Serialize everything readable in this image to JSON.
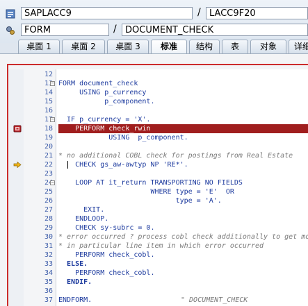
{
  "header": {
    "program": "SAPLACC9",
    "include": "LACC9F20",
    "object_type": "FORM",
    "object_name": "DOCUMENT_CHECK",
    "separator": "/"
  },
  "tabs": [
    {
      "label": "桌面 1",
      "active": false
    },
    {
      "label": "桌面 2",
      "active": false
    },
    {
      "label": "桌面 3",
      "active": false
    },
    {
      "label": "标准",
      "active": true
    },
    {
      "label": "结构",
      "active": false
    },
    {
      "label": "表",
      "active": false
    },
    {
      "label": "对象",
      "active": false
    },
    {
      "label": "详细",
      "active": false
    }
  ],
  "colors": {
    "highlight": "#a01e1e",
    "keyword": "#1c3a9e",
    "comment": "#7a7a7a",
    "frame": "#cc2b2b"
  },
  "code_lines": [
    {
      "num": "12",
      "text": "",
      "fold": "",
      "type": "code"
    },
    {
      "num": "13",
      "text": "FORM document_check",
      "fold": "−",
      "type": "code"
    },
    {
      "num": "14",
      "text": "     USING p_currency",
      "fold": "",
      "type": "code"
    },
    {
      "num": "15",
      "text": "           p_component.",
      "fold": "",
      "type": "code"
    },
    {
      "num": "16",
      "text": "",
      "fold": "",
      "type": "code"
    },
    {
      "num": "17",
      "text": "  IF p_currency = 'X'.",
      "fold": "−",
      "type": "code"
    },
    {
      "num": "18",
      "text": "    PERFORM check_rwin",
      "fold": "",
      "type": "highlight",
      "marker": "breakpoint"
    },
    {
      "num": "19",
      "text": "            USING  p_component.",
      "fold": "",
      "type": "code"
    },
    {
      "num": "20",
      "text": "",
      "fold": "",
      "type": "code"
    },
    {
      "num": "21",
      "text": "* no additional COBL check for postings from Real Estate",
      "fold": "",
      "type": "comment"
    },
    {
      "num": "22",
      "text": "    CHECK gs_aw-awtyp NP 'RE*'.",
      "fold": "",
      "type": "code",
      "marker": "current"
    },
    {
      "num": "23",
      "text": "",
      "fold": "",
      "type": "code"
    },
    {
      "num": "24",
      "text": "    LOOP AT it_return TRANSPORTING NO FIELDS",
      "fold": "−",
      "type": "code"
    },
    {
      "num": "25",
      "text": "                      WHERE type = 'E'  OR",
      "fold": "",
      "type": "code"
    },
    {
      "num": "26",
      "text": "                            type = 'A'.",
      "fold": "",
      "type": "code"
    },
    {
      "num": "27",
      "text": "      EXIT.",
      "fold": "",
      "type": "code"
    },
    {
      "num": "28",
      "text": "    ENDLOOP.",
      "fold": "",
      "type": "code"
    },
    {
      "num": "29",
      "text": "    CHECK sy-subrc = 0.",
      "fold": "",
      "type": "code"
    },
    {
      "num": "30",
      "text": "* error occurred ? process cobl check additionally to get more",
      "fold": "",
      "type": "comment"
    },
    {
      "num": "31",
      "text": "* in particular line item in which error occurred",
      "fold": "",
      "type": "comment"
    },
    {
      "num": "32",
      "text": "    PERFORM check_cobl.",
      "fold": "",
      "type": "code"
    },
    {
      "num": "33",
      "text": "  ELSE.",
      "fold": "",
      "type": "kwbold"
    },
    {
      "num": "34",
      "text": "    PERFORM check_cobl.",
      "fold": "",
      "type": "code"
    },
    {
      "num": "35",
      "text": "  ENDIF.",
      "fold": "",
      "type": "kwbold"
    },
    {
      "num": "36",
      "text": "",
      "fold": "",
      "type": "code"
    },
    {
      "num": "37",
      "text": "ENDFORM.",
      "fold": "",
      "type": "code",
      "trailing_comment": "\" DOCUMENT_CHECK"
    }
  ]
}
